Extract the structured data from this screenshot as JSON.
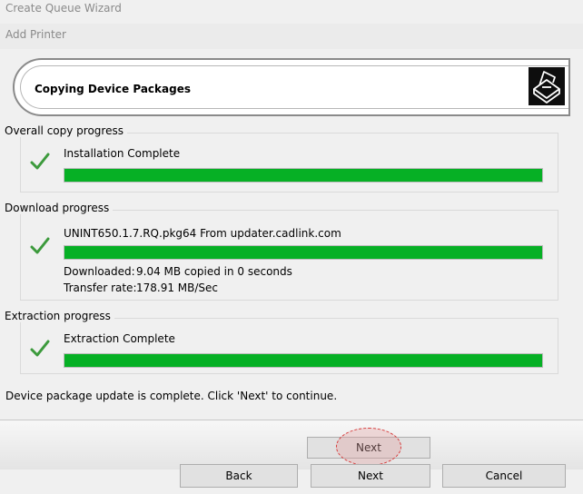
{
  "window": {
    "title": "Create Queue Wizard",
    "subtitle": "Add Printer"
  },
  "header": {
    "title": "Copying Device Packages",
    "icon": "printer-icon"
  },
  "overall": {
    "legend": "Overall copy progress",
    "status": "Installation Complete",
    "progress_percent": 100,
    "icon": "checkmark-icon"
  },
  "download": {
    "legend": "Download progress",
    "status": "UNINT650.1.7.RQ.pkg64 From updater.cadlink.com",
    "progress_percent": 100,
    "downloaded_label": "Downloaded:",
    "downloaded_value": "9.04 MB copied in 0 seconds",
    "rate_label": "Transfer rate:",
    "rate_value": "178.91 MB/Sec",
    "icon": "checkmark-icon"
  },
  "extraction": {
    "legend": "Extraction progress",
    "status": "Extraction Complete",
    "progress_percent": 100,
    "icon": "checkmark-icon"
  },
  "message": "Device package update is complete. Click 'Next' to continue.",
  "buttons": {
    "next_highlight": "Next",
    "back": "Back",
    "next": "Next",
    "cancel": "Cancel"
  },
  "colors": {
    "progress": "#06b025",
    "check": "#3c9a3c",
    "highlight": "#d63a3a"
  }
}
